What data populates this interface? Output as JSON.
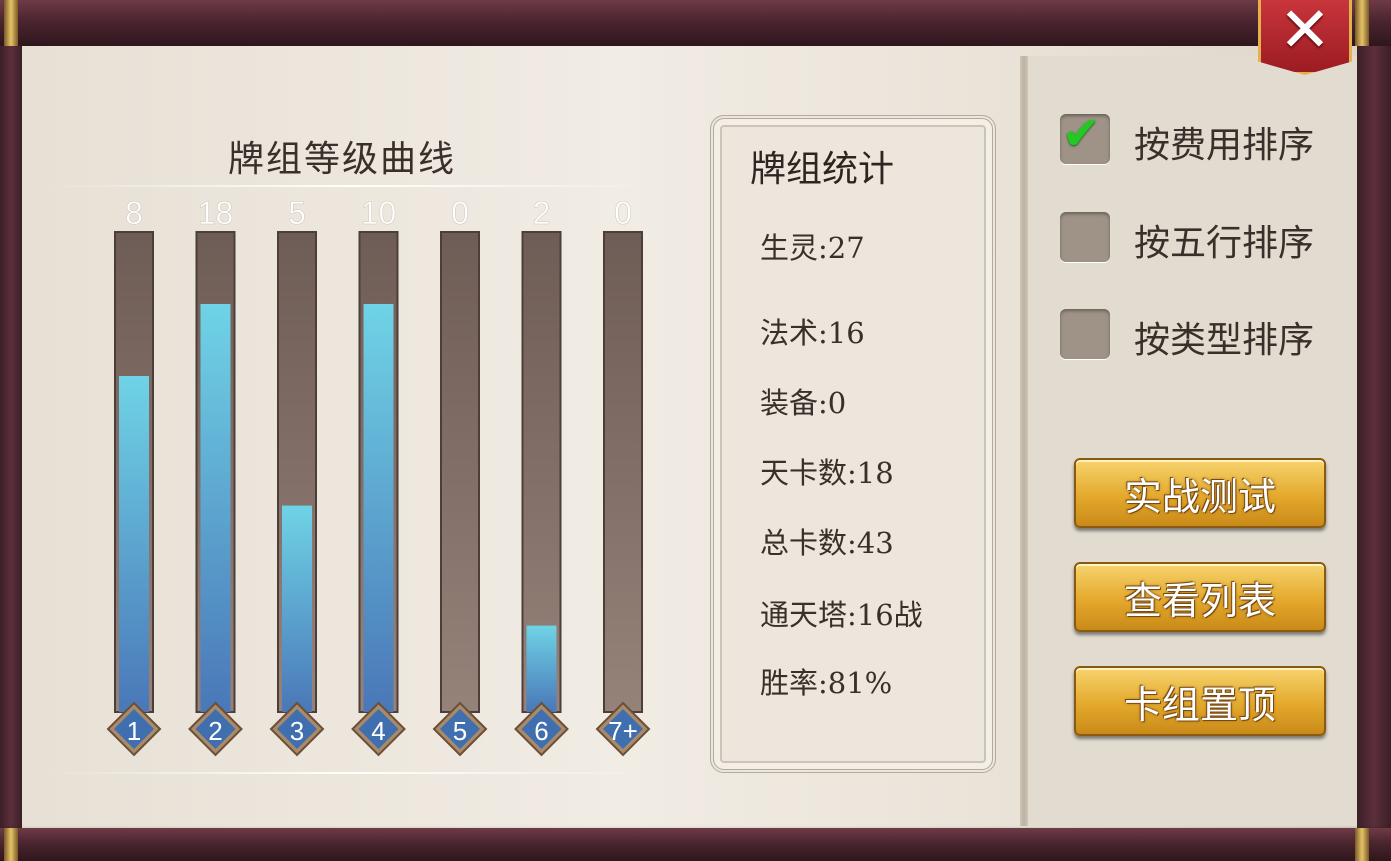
{
  "close_button": {
    "label": "✕"
  },
  "chart_data": {
    "type": "bar",
    "title": "牌组等级曲线",
    "categories": [
      "1",
      "2",
      "3",
      "4",
      "5",
      "6",
      "7+"
    ],
    "values": [
      8,
      18,
      5,
      10,
      0,
      2,
      0
    ],
    "fill_fraction": [
      0.7,
      0.85,
      0.43,
      0.85,
      0,
      0.18,
      0
    ],
    "colors": {
      "fill_top": "#6fd3e6",
      "fill_bottom": "#4a77b8",
      "track": "#8a7870",
      "badge": "#3f6fae"
    }
  },
  "stats": {
    "title": "牌组统计",
    "items": [
      "生灵:27",
      "法术:16",
      "装备:0",
      "天卡数:18",
      "总卡数:43",
      "通天塔:16战",
      "胜率:81%"
    ]
  },
  "sort_options": [
    {
      "label": "按费用排序",
      "checked": true
    },
    {
      "label": "按五行排序",
      "checked": false
    },
    {
      "label": "按类型排序",
      "checked": false
    }
  ],
  "buttons": [
    "实战测试",
    "查看列表",
    "卡组置顶"
  ]
}
